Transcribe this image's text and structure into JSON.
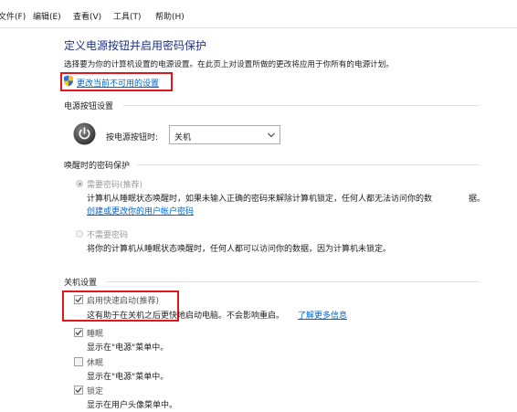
{
  "menu": {
    "file": "文件(F)",
    "edit": "编辑(E)",
    "view": "查看(V)",
    "tools": "工具(T)",
    "help": "帮助(H)"
  },
  "page": {
    "title": "定义电源按钮并启用密码保护",
    "subtitle": "选择要为你的计算机设置的电源设置。在此页上对设置所做的更改将应用于你所有的电源计划。",
    "change_link": "更改当前不可用的设置"
  },
  "power_button": {
    "heading": "电源按钮设置",
    "label": "按电源按钮时:",
    "selected": "关机"
  },
  "password": {
    "heading": "唤醒时的密码保护",
    "require": {
      "label": "需要密码(推荐)",
      "desc": "计算机从睡眠状态唤醒时，如果未输入正确的密码来解除计算机锁定，任何人都无法访问你的数",
      "desc2": "据。",
      "link": "创建或更改你的用户帐户密码",
      "selected": true
    },
    "no_require": {
      "label": "不需要密码",
      "desc": "将你的计算机从睡眠状态唤醒时，任何人都可以访问你的数据，因为计算机未锁定。",
      "selected": false
    }
  },
  "shutdown": {
    "heading": "关机设置",
    "fast_startup": {
      "label": "启用快速启动(推荐)",
      "desc": "这有助于在关机之后更快地启动电脑。不会影响重启。",
      "link": "了解更多信息",
      "checked": true
    },
    "sleep": {
      "label": "睡眠",
      "desc": "显示在\"电源\"菜单中。",
      "checked": true
    },
    "hibernate": {
      "label": "休眠",
      "desc": "显示在\"电源\"菜单中。",
      "checked": false
    },
    "lock": {
      "label": "锁定",
      "desc": "显示在用户头像菜单中。",
      "checked": true
    }
  },
  "colors": {
    "accent_red": "#e3171b",
    "link_blue": "#0066cc",
    "title_blue": "#1e3287"
  },
  "icons": {
    "shield": "uac-shield-icon",
    "power": "power-button-icon"
  }
}
